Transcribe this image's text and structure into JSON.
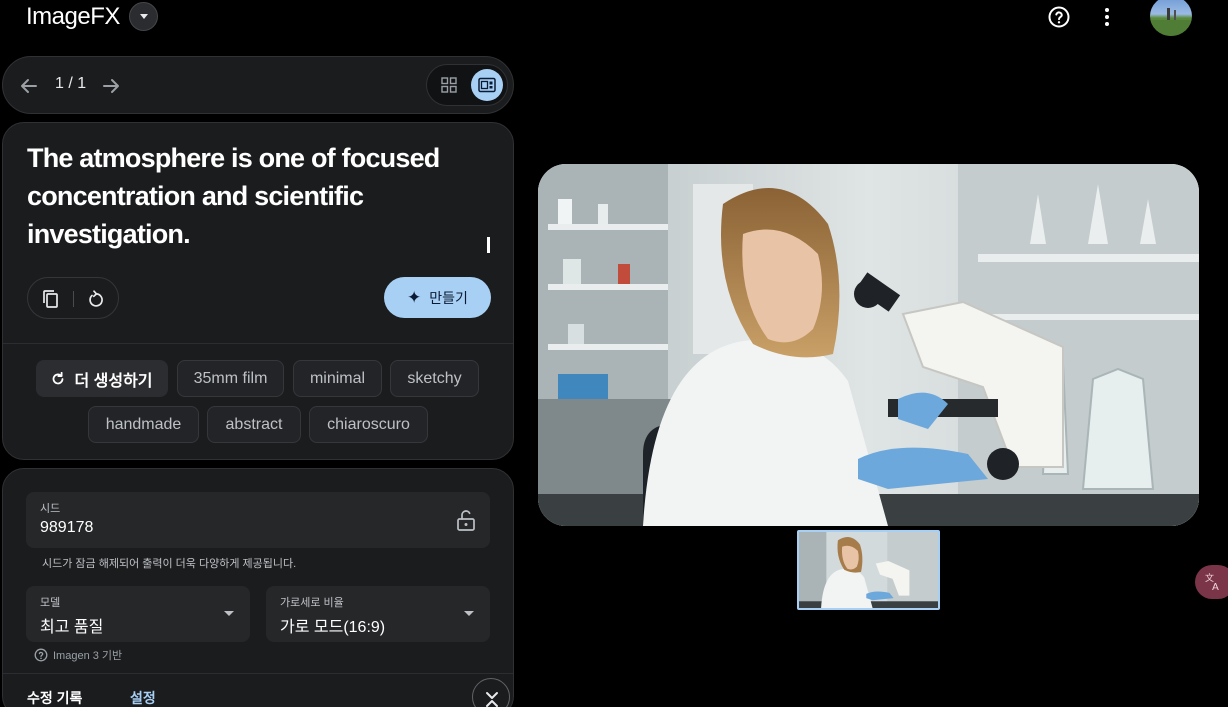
{
  "header": {
    "brand": "ImageFX"
  },
  "pager": {
    "count": "1 / 1"
  },
  "prompt": {
    "text": "The atmosphere is one of focused concentration and scientific investigation.",
    "create_label": "만들기"
  },
  "chips": {
    "more_label": "더 생성하기",
    "styles": [
      "35mm film",
      "minimal",
      "sketchy",
      "handmade",
      "abstract",
      "chiaroscuro"
    ]
  },
  "settings": {
    "seed_label": "시드",
    "seed_value": "989178",
    "seed_note": "시드가 잠금 해제되어 출력이 더욱 다양하게 제공됩니다.",
    "model_label": "모델",
    "model_value": "최고 품질",
    "ratio_label": "가로세로 비율",
    "ratio_value": "가로 모드(16:9)",
    "model_note": "Imagen 3 기반"
  },
  "tabs": {
    "history": "수정 기록",
    "settings": "설정"
  },
  "colors": {
    "accent": "#a8d0f5",
    "background": "#000000",
    "card": "#1b1c1e"
  }
}
